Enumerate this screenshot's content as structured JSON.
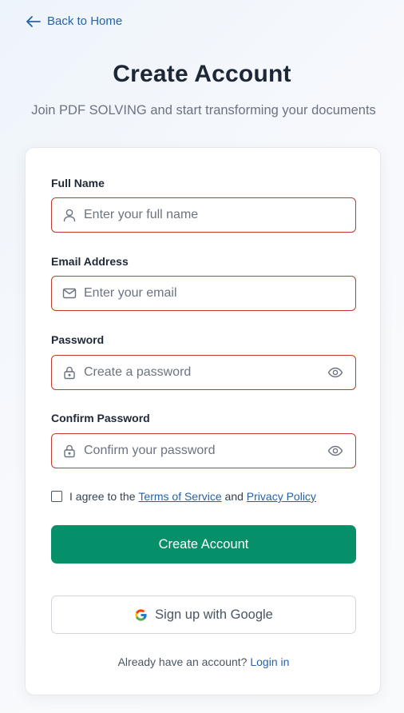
{
  "nav": {
    "back_label": "Back to Home",
    "back_icon": "arrow-left-icon"
  },
  "header": {
    "title": "Create Account",
    "subtitle": "Join PDF SOLVING and start transforming your documents"
  },
  "form": {
    "full_name": {
      "label": "Full Name",
      "placeholder": "Enter your full name",
      "value": "",
      "icon": "user-icon"
    },
    "email": {
      "label": "Email Address",
      "placeholder": "Enter your email",
      "value": "",
      "icon": "mail-icon"
    },
    "password": {
      "label": "Password",
      "placeholder": "Create a password",
      "value": "",
      "icon": "lock-icon",
      "toggle_icon": "eye-icon"
    },
    "confirm_password": {
      "label": "Confirm Password",
      "placeholder": "Confirm your password",
      "value": "",
      "icon": "lock-icon",
      "toggle_icon": "eye-icon"
    },
    "agreement": {
      "checked": false,
      "prefix": "I agree to the",
      "terms_link": "Terms of Service",
      "conjunction": "and",
      "privacy_link": "Privacy Policy"
    },
    "submit_label": "Create Account",
    "google_label": "Sign up with Google",
    "google_icon": "google-icon",
    "login_prompt": "Already have an account?",
    "login_link": "Login in"
  },
  "colors": {
    "accent_green": "#06906a",
    "link_blue": "#2563a8",
    "error_border": "#c0392b",
    "title_text": "#1e2736"
  }
}
